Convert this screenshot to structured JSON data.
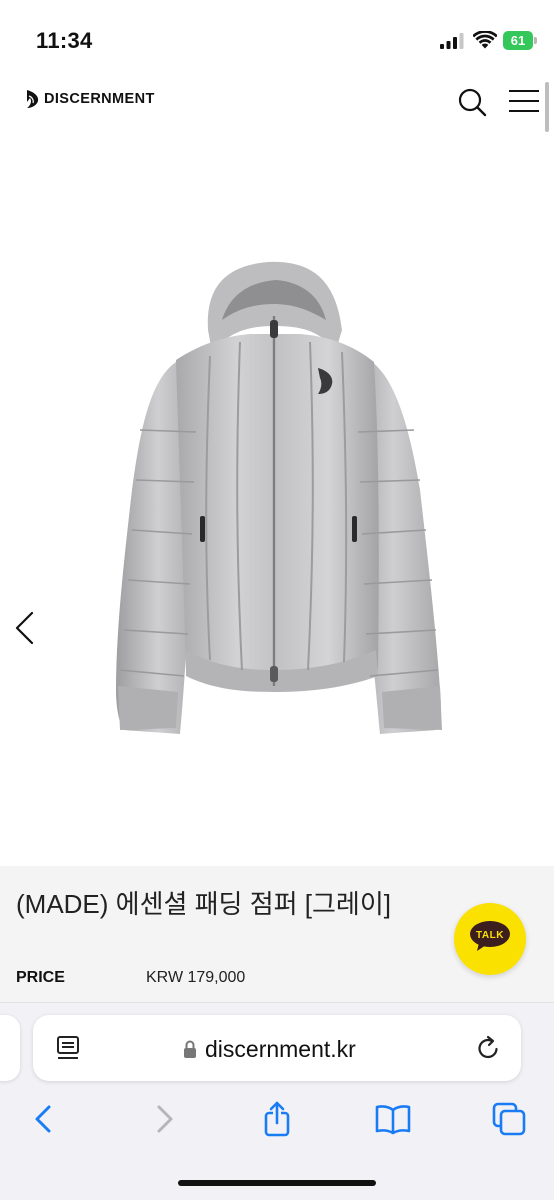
{
  "status_bar": {
    "time": "11:34",
    "battery": "61",
    "battery_color": "#34c759"
  },
  "site": {
    "logo_text": "DISCERNMENT",
    "icons": [
      "logo-icon",
      "search-icon",
      "hamburger-menu-icon"
    ]
  },
  "product": {
    "image_icon": "jacket-image",
    "title": "(MADE) 에센셜 패딩 점퍼 [그레이]",
    "price_label": "PRICE",
    "price_value": "KRW 179,000",
    "talk_label": "TALK",
    "talk_color": "#fae100"
  },
  "browser": {
    "url": "discernment.kr",
    "accent": "#1a7cf5",
    "toolbar_icons": [
      "back-icon",
      "forward-icon",
      "share-icon",
      "bookmarks-icon",
      "tabs-icon"
    ]
  }
}
